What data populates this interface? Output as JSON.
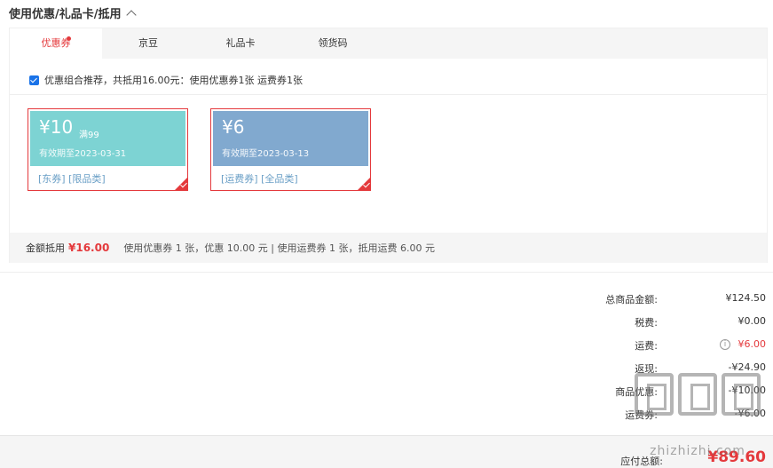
{
  "section": {
    "title": "使用优惠/礼品卡/抵用"
  },
  "tabs": [
    {
      "label": "优惠券",
      "active": true
    },
    {
      "label": "京豆",
      "active": false
    },
    {
      "label": "礼品卡",
      "active": false
    },
    {
      "label": "领货码",
      "active": false
    }
  ],
  "recommend": {
    "checked": true,
    "text": "优惠组合推荐，共抵用16.00元：使用优惠券1张 运费券1张"
  },
  "coupons": [
    {
      "amount": "¥10",
      "condition": "满99",
      "valid": "有效期至2023-03-31",
      "tags": "[东券]  [限品类]",
      "color": "#7dd3d3",
      "selected": true
    },
    {
      "amount": "¥6",
      "condition": "",
      "valid": "有效期至2023-03-13",
      "tags": "[运费券]  [全品类]",
      "color": "#81a9cf",
      "selected": true
    }
  ],
  "summary": {
    "label": "金额抵用",
    "amount": "¥16.00",
    "desc": "使用优惠券 1 张，优惠 10.00 元  | 使用运费券 1 张，抵用运费 6.00 元"
  },
  "totals": [
    {
      "label": "总商品金额:",
      "value": "¥124.50"
    },
    {
      "label": "税费:",
      "value": "¥0.00"
    },
    {
      "label": "运费:",
      "value": "¥6.00",
      "highlight": true
    },
    {
      "label": "返现:",
      "value": "-¥24.90"
    },
    {
      "label": "商品优惠:",
      "value": "-¥10.00"
    },
    {
      "label": "运费券:",
      "value": "-¥6.00"
    }
  ],
  "payable": {
    "label": "应付总额:",
    "amount": "¥89.60"
  },
  "watermark": {
    "text": "zhizhizhi.com"
  },
  "colors": {
    "accent": "#e4393c",
    "coupon_jd": "#7dd3d3",
    "coupon_freight": "#81a9cf"
  }
}
